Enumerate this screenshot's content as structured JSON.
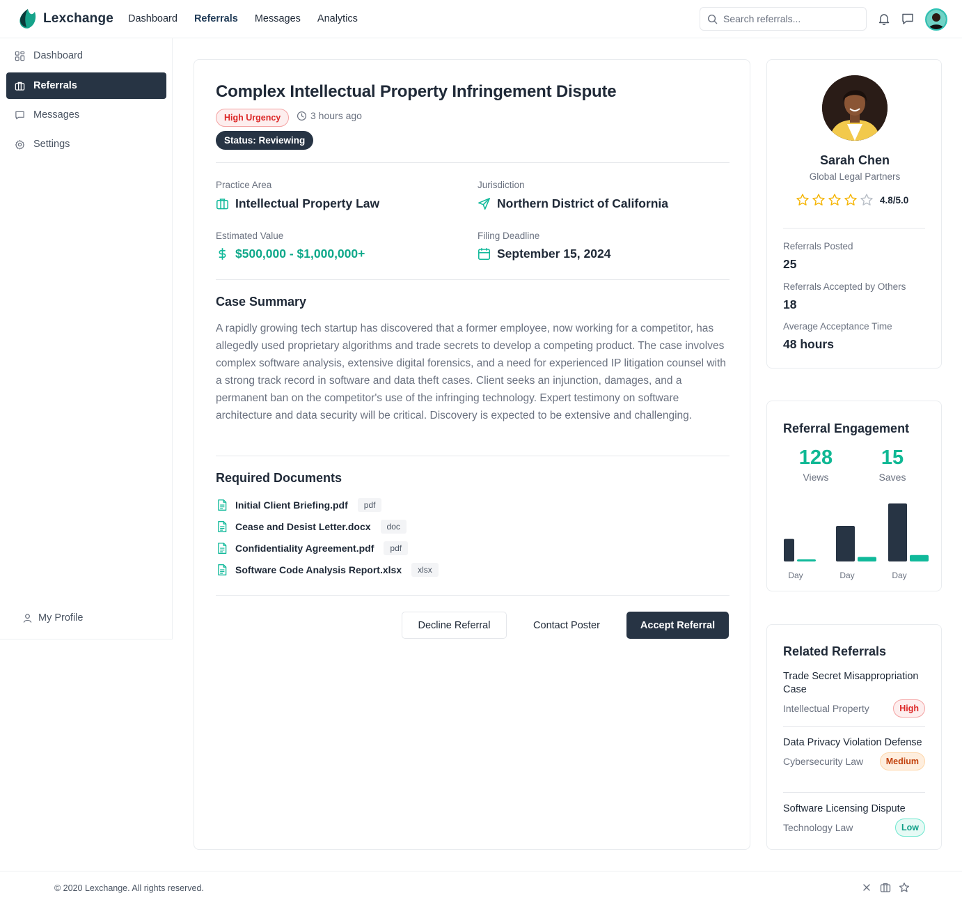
{
  "app": {
    "name": "Lexchange"
  },
  "nav": {
    "items": [
      "Dashboard",
      "Referrals",
      "Messages",
      "Analytics"
    ],
    "active": "Referrals"
  },
  "search": {
    "placeholder": "Search referrals..."
  },
  "sidebar": {
    "items": [
      {
        "label": "Dashboard",
        "icon": "grid-icon"
      },
      {
        "label": "Referrals",
        "icon": "briefcase-icon"
      },
      {
        "label": "Messages",
        "icon": "message-icon"
      },
      {
        "label": "Settings",
        "icon": "gear-icon"
      }
    ],
    "active": "Referrals",
    "profile_label": "My Profile"
  },
  "referral": {
    "title": "Complex Intellectual Property Infringement Dispute",
    "urgency": "High Urgency",
    "posted": "3 hours ago",
    "status": "Status: Reviewing",
    "practice_area_label": "Practice Area",
    "practice_area": "Intellectual Property Law",
    "jurisdiction_label": "Jurisdiction",
    "jurisdiction": "Northern District of California",
    "value_label": "Estimated Value",
    "value": "$500,000 - $1,000,000+",
    "deadline_label": "Filing Deadline",
    "deadline": "September 15, 2024",
    "summary_title": "Case Summary",
    "summary": "A rapidly growing tech startup has discovered that a former employee, now working for a competitor, has allegedly used proprietary algorithms and trade secrets to develop a competing product. The case involves complex software analysis, extensive digital forensics, and a need for experienced IP litigation counsel with a strong track record in software and data theft cases. Client seeks an injunction, damages, and a permanent ban on the competitor's use of the infringing technology. Expert testimony on software architecture and data security will be critical. Discovery is expected to be extensive and challenging.",
    "documents_title": "Required Documents",
    "documents": [
      {
        "name": "Initial Client Briefing.pdf",
        "type": "pdf"
      },
      {
        "name": "Cease and Desist Letter.docx",
        "type": "doc"
      },
      {
        "name": "Confidentiality Agreement.pdf",
        "type": "pdf"
      },
      {
        "name": "Software Code Analysis Report.xlsx",
        "type": "xlsx"
      }
    ],
    "actions": {
      "decline": "Decline Referral",
      "contact": "Contact Poster",
      "accept": "Accept Referral"
    }
  },
  "poster": {
    "name": "Sarah Chen",
    "firm": "Global Legal Partners",
    "rating": "4.8/5.0",
    "stars_filled": 4,
    "stars_total": 5,
    "stats": [
      {
        "label": "Referrals Posted",
        "value": "25"
      },
      {
        "label": "Referrals Accepted by Others",
        "value": "18"
      },
      {
        "label": "Average Acceptance Time",
        "value": "48 hours"
      }
    ]
  },
  "engagement": {
    "title": "Referral Engagement",
    "views": "128",
    "views_label": "Views",
    "saves": "15",
    "saves_label": "Saves"
  },
  "chart_data": {
    "type": "bar",
    "categories": [
      "Day",
      "Day",
      "Day"
    ],
    "series": [
      {
        "name": "Views",
        "values": [
          35,
          55,
          90
        ],
        "color": "#273444"
      },
      {
        "name": "Saves",
        "values": [
          3,
          7,
          10
        ],
        "color": "#10b99a"
      }
    ],
    "ylim": [
      0,
      95
    ],
    "grid": false
  },
  "related": {
    "title": "Related Referrals",
    "items": [
      {
        "title": "Trade Secret Misappropriation Case",
        "area": "Intellectual Property",
        "level": "High"
      },
      {
        "title": "Data Privacy Violation Defense",
        "area": "Cybersecurity Law",
        "level": "Medium"
      },
      {
        "title": "Software Licensing Dispute",
        "area": "Technology Law",
        "level": "Low"
      }
    ]
  },
  "footer": {
    "copyright": "© 2020 Lexchange. All rights reserved."
  },
  "colors": {
    "primary": "#273444",
    "accent": "#10b99a",
    "urgent": "#dc2626"
  }
}
